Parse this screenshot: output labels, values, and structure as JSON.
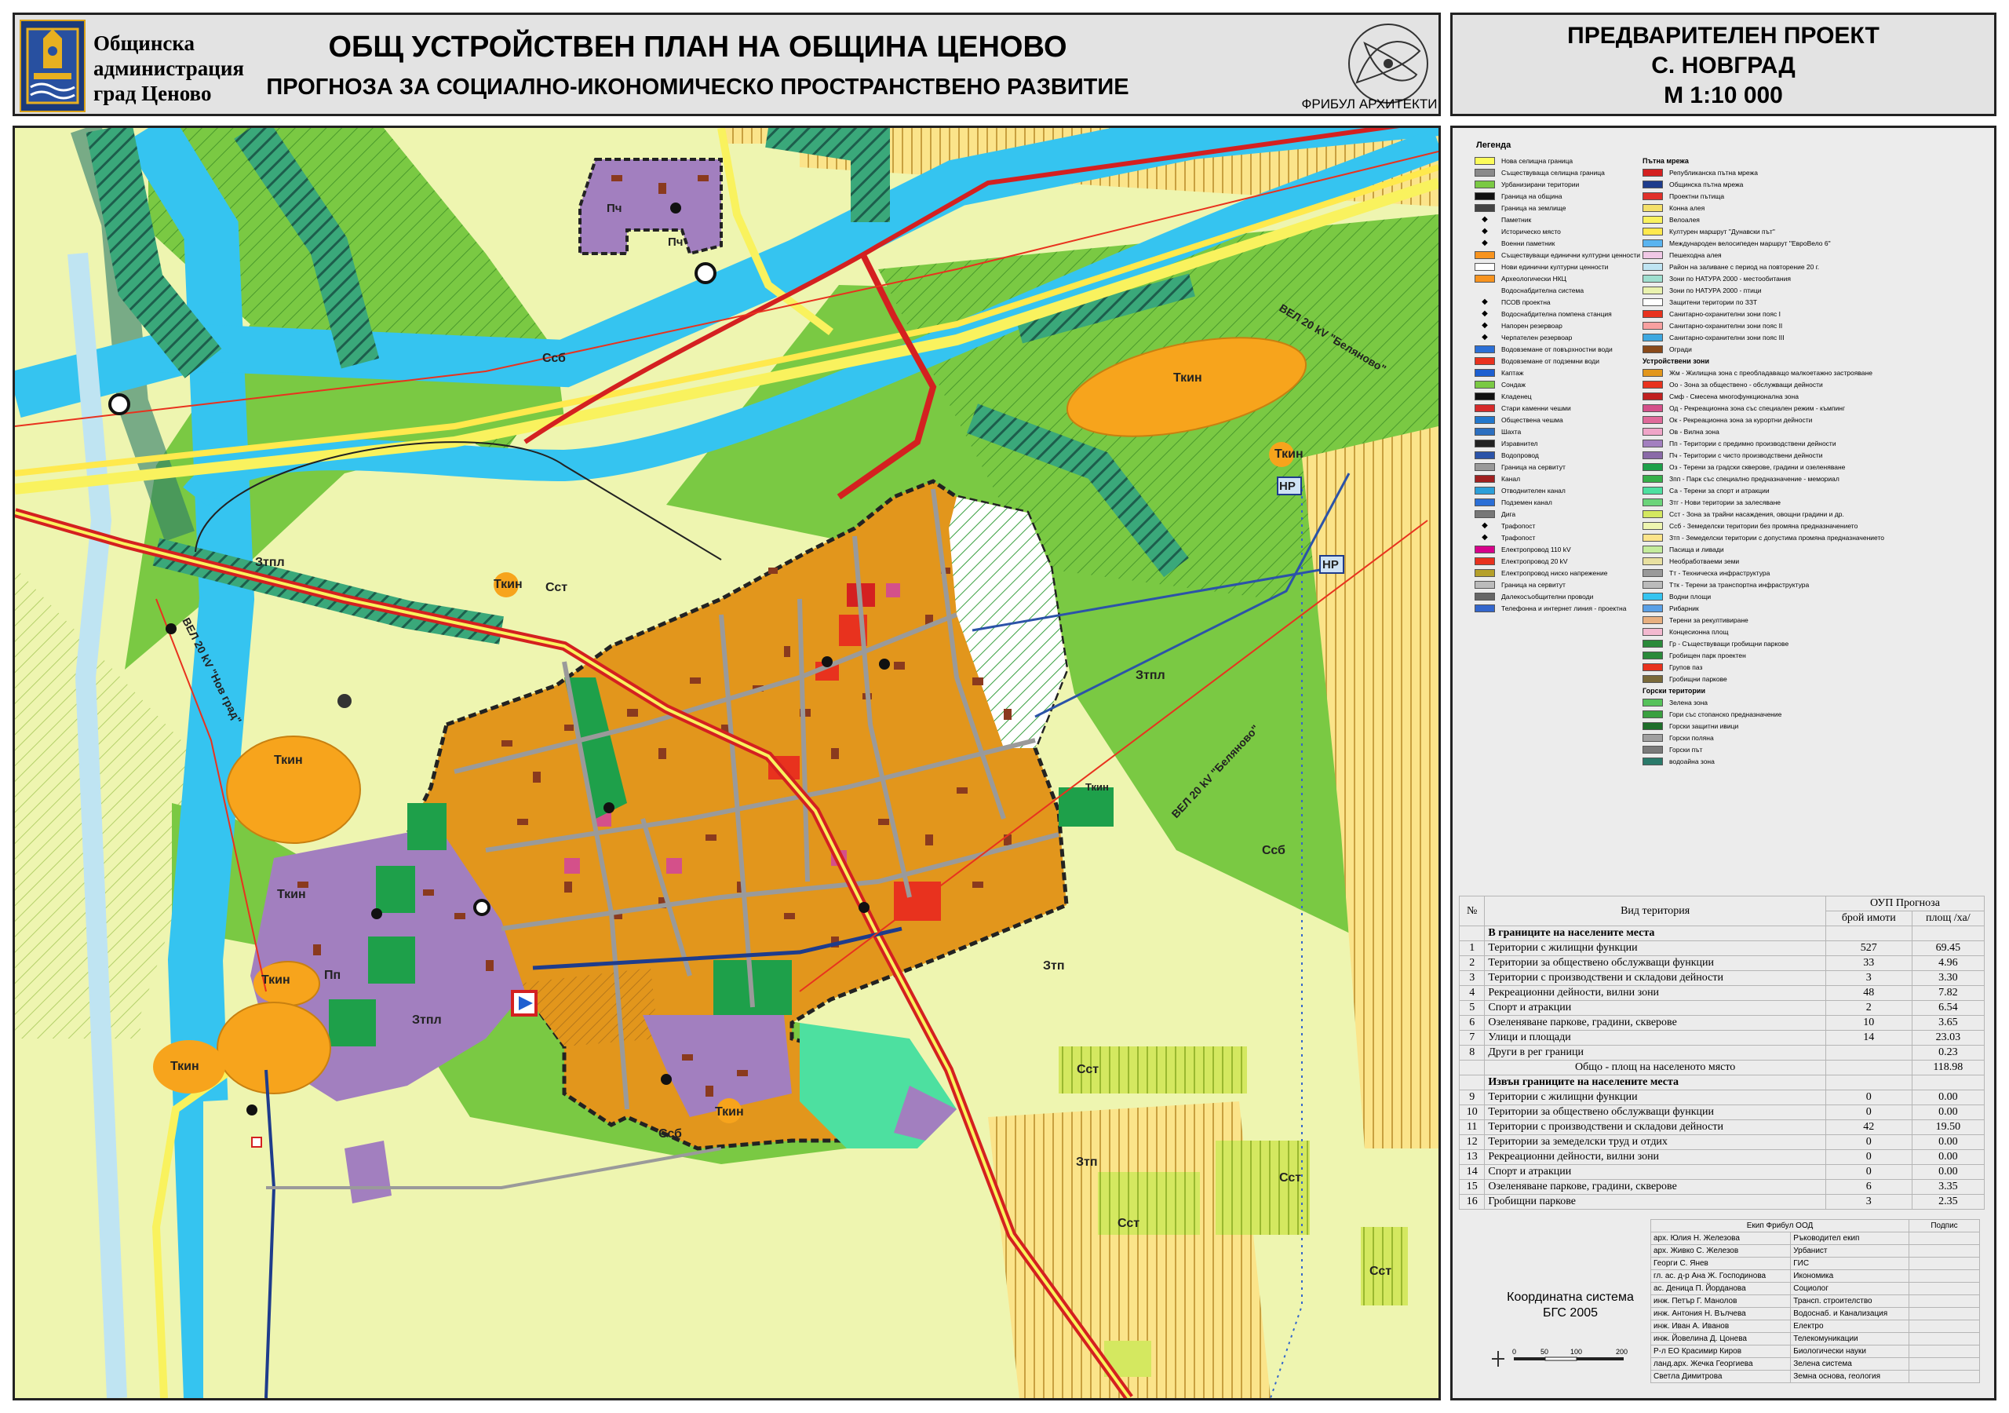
{
  "header": {
    "admin_lines": [
      "Общинска",
      "администрация",
      "град Ценово"
    ],
    "title": "ОБЩ УСТРОЙСТВЕН ПЛАН НА ОБЩИНА ЦЕНОВО",
    "subtitle": "ПРОГНОЗА ЗА СОЦИАЛНО-ИКОНОМИЧЕСКО ПРОСТРАНСТВЕНО РАЗВИТИЕ",
    "firm": "ФРИБУЛ АРХИТЕКТИ"
  },
  "project": {
    "line1": "ПРЕДВАРИТЕЛЕН ПРОЕКТ",
    "line2": "С. НОВГРАД",
    "line3": "М 1:10 000"
  },
  "map": {
    "labels": {
      "ssb_north": "Ссб",
      "tkin_ne": "Ткин",
      "tkin_east": "Ткин",
      "nr1": "НР",
      "nr2": "НР",
      "ztpl_west": "Зтпл",
      "tkin_center": "Ткин",
      "sst_center": "Сст",
      "ztpl_east": "Зтпл",
      "tkin_w1": "Ткин",
      "tkin_w2": "Ткин",
      "tkin_w3": "Ткин",
      "tkin_w4": "Ткин",
      "pp": "Пп",
      "ztpl_sw": "Зтпл",
      "ssb_south": "Ссб",
      "tkin_south": "Ткин",
      "ztp1": "Зтп",
      "ztp2": "Зтп",
      "sst_s1": "Сст",
      "sst_s2": "Сст",
      "sst_s3": "Сст",
      "sst_s4": "Сст",
      "ssb_east": "Ссб",
      "tkin_road": "Ткин",
      "vel_belyanovo_n": "ВЕЛ 20 kV \"Беляново\"",
      "vel_belyanovo_s": "ВЕЛ 20 kV \"Беляново\"",
      "vel_novgrad": "ВЕЛ 20 kV \"Нов град\"",
      "pch1": "Пч",
      "pch2": "Пч"
    }
  },
  "legend": {
    "title": "Легенда",
    "left_items": [
      {
        "label": "Нова селищна граница",
        "color": "#fcfc5a"
      },
      {
        "label": "Съществуваща селищна граница",
        "color": "#8a8a8a"
      },
      {
        "label": "Урбанизирани територии",
        "color": "#7ac943"
      },
      {
        "label": "Граница на община",
        "color": "#111111"
      },
      {
        "label": "Граница на землище",
        "color": "#444444"
      },
      {
        "label": "Паметник",
        "icon": "monument-icon"
      },
      {
        "label": "Историческо място",
        "icon": "historic-place-icon"
      },
      {
        "label": "Военни паметник",
        "icon": "military-monument-icon"
      },
      {
        "label": "Съществуващи единични културни ценности",
        "color": "#f7931e"
      },
      {
        "label": "Нови единични културни ценности",
        "color": "#ffffff"
      },
      {
        "label": "Археологически НКЦ",
        "color": "#f7931e"
      },
      {
        "label": "Водоснабдителна система",
        "color": ""
      },
      {
        "label": "ПСОВ проектна",
        "icon": "wastewater-plant-icon"
      },
      {
        "label": "Водоснабдителна помпена станция",
        "icon": "pump-station-icon"
      },
      {
        "label": "Напорен резервоар",
        "icon": "pressure-tank-icon"
      },
      {
        "label": "Черпателен резервоар",
        "icon": "intake-tank-icon"
      },
      {
        "label": "Водовземане от повърхностни води",
        "color": "#2b6fd6"
      },
      {
        "label": "Водовземане от подземни води",
        "color": "#e8321e"
      },
      {
        "label": "Каптаж",
        "color": "#1d5fd0"
      },
      {
        "label": "Сондаж",
        "color": "#7ac943"
      },
      {
        "label": "Кладенец",
        "color": "#111111"
      },
      {
        "label": "Стари каменни чешми",
        "color": "#d62a2a"
      },
      {
        "label": "Обществена чешма",
        "color": "#2277cc"
      },
      {
        "label": "Шахта",
        "color": "#2c6fbf"
      },
      {
        "label": "Изравнител",
        "color": "#222222"
      },
      {
        "label": "Водопровод",
        "color": "#2b53a8"
      },
      {
        "label": "Граница на сервитут",
        "color": "#999999"
      },
      {
        "label": "Канал",
        "color": "#a02020"
      },
      {
        "label": "Отводнителен канал",
        "color": "#2b9fd9"
      },
      {
        "label": "Подземен канал",
        "color": "#2b6fd6"
      },
      {
        "label": "Дига",
        "color": "#777777"
      },
      {
        "label": "Трафопост",
        "icon": "transformer-icon"
      },
      {
        "label": "Трафопост",
        "icon": "transformer-icon"
      },
      {
        "label": "Електропровод 110 kV",
        "color": "#d6008a"
      },
      {
        "label": "Електропровод 20 kV",
        "color": "#e8321e"
      },
      {
        "label": "Електропровод ниско напрежение",
        "color": "#b5a02a"
      },
      {
        "label": "Граница на сервитут",
        "color": "#bbbbbb"
      },
      {
        "label": "Далекосъобщителни проводи",
        "color": "#666666"
      },
      {
        "label": "Телефонна и интернет линия - проектна",
        "color": "#3366cc"
      }
    ],
    "right_items": [
      {
        "label": "Пътна мрежа",
        "header": true
      },
      {
        "label": "Републиканска пътна мрежа",
        "color": "#d42020"
      },
      {
        "label": "Общинска пътна мрежа",
        "color": "#1e3c8c"
      },
      {
        "label": "Проектни пътища",
        "color": "#e0302a"
      },
      {
        "label": "Конна алея",
        "color": "#f4e06a"
      },
      {
        "label": "Велоалея",
        "color": "#f9f25e"
      },
      {
        "label": "Културен маршрут \"Дунавски път\"",
        "color": "#ffe94d"
      },
      {
        "label": "Международен велосипеден маршрут \"ЕвроВело 6\"",
        "color": "#5ab4f0"
      },
      {
        "label": "Пешеходна алея",
        "color": "#f0c8e6"
      },
      {
        "label": "Район на заливане с период на повторение 20 г.",
        "color": "#bfe4f2"
      },
      {
        "label": "Зони по НАТУРА 2000 - местообитания",
        "color": "#9fdfcf"
      },
      {
        "label": "Зони по НАТУРА 2000 - птици",
        "color": "#e9f2ae"
      },
      {
        "label": "Защитени територии по ЗЗТ",
        "color": "#ffffff"
      },
      {
        "label": "Санитарно-охранителни зони пояс I",
        "color": "#e8321e"
      },
      {
        "label": "Санитарно-охранителни зони пояс II",
        "color": "#f8a0a0"
      },
      {
        "label": "Санитарно-охранителни зони пояс III",
        "color": "#3ea8e0"
      },
      {
        "label": "Огради",
        "color": "#8a4a1a"
      },
      {
        "label": "Устройствени зони",
        "header": true
      },
      {
        "label": "Жм - Жилищна зона с преобладаващо малкоетажно застрояване",
        "color": "#e2961c"
      },
      {
        "label": "Оо - Зона за обществено - обслужващи дейности",
        "color": "#e8321e"
      },
      {
        "label": "Смф - Смесена многофункционална зона",
        "color": "#c02020"
      },
      {
        "label": "Од - Рекреационна зона със специален режим - къмпинг",
        "color": "#d4508a"
      },
      {
        "label": "Ок - Рекреационна зона за курортни дейности",
        "color": "#e06a9a"
      },
      {
        "label": "Ов - Вилна зона",
        "color": "#f0a5c8"
      },
      {
        "label": "Пп - Територии с предимно производствени дейности",
        "color": "#a27fbf"
      },
      {
        "label": "Пч - Територии с чисто производствени дейности",
        "color": "#8a6aa8"
      },
      {
        "label": "Оз - Терени за градски скверове, градини и озеленяване",
        "color": "#1ea04a"
      },
      {
        "label": "Зпп - Парк със специално предназначение - мемориал",
        "color": "#36b04a"
      },
      {
        "label": "Са - Терени за спорт и атракции",
        "color": "#4de0a0"
      },
      {
        "label": "Зтг - Нови територии за залесяване",
        "color": "#6bd47a"
      },
      {
        "label": "Сст - Зона за трайни насаждения, овощни градини и др.",
        "color": "#d4e860"
      },
      {
        "label": "Ссб - Земеделски територии без промяна предназначението",
        "color": "#eef5b0"
      },
      {
        "label": "Зтп - Земеделски територии с допустима промяна предназначението",
        "color": "#fbe48a"
      },
      {
        "label": "Пасища и ливади",
        "color": "#c4ec9c"
      },
      {
        "label": "Необработваеми земи",
        "color": "#e8e0a0"
      },
      {
        "label": "Тт - Техническа инфраструктура",
        "color": "#999999"
      },
      {
        "label": "Ттк - Терени за транспортна инфраструктура",
        "color": "#bbbbbb"
      },
      {
        "label": "Водни площи",
        "color": "#35c4f0"
      },
      {
        "label": "Рибарник",
        "color": "#5aa0e6"
      },
      {
        "label": "Терени за рекултивиране",
        "color": "#e8b080"
      },
      {
        "label": "Концесионна площ",
        "color": "#f3b9d0"
      },
      {
        "label": "Гр - Съществуващи гробищни паркове",
        "color": "#2a8a3a"
      },
      {
        "label": "Гробищен парк проектен",
        "color": "#2a8a3a"
      },
      {
        "label": "Групов паз",
        "color": "#e8321e"
      },
      {
        "label": "Гробищни паркове",
        "color": "#7a6a3a"
      },
      {
        "label": "Горски територии",
        "header": true
      },
      {
        "label": "Зелена зона",
        "color": "#56c25a"
      },
      {
        "label": "Гори със стопанско предназначение",
        "color": "#3aa040"
      },
      {
        "label": "Горски защитни ивици",
        "color": "#1e6e2a"
      },
      {
        "label": "Горски поляна",
        "color": "#a0a0a0"
      },
      {
        "label": "Горски път",
        "color": "#7a7a7a"
      },
      {
        "label": "водоайна зона",
        "color": "#2a7a6a"
      }
    ]
  },
  "stats_table": {
    "headers": {
      "no": "№",
      "type": "Вид територия",
      "oup": "ОУП Прогноза",
      "count": "брой имоти",
      "area": "площ /ха/"
    },
    "section_in": "В границите на населените места",
    "rows_in": [
      {
        "no": "1",
        "name": "Територии с жилищни функции",
        "count": "527",
        "area": "69.45"
      },
      {
        "no": "2",
        "name": "Територии за обществено обслужващи функции",
        "count": "33",
        "area": "4.96"
      },
      {
        "no": "3",
        "name": "Територии с производствени и складови дейности",
        "count": "3",
        "area": "3.30"
      },
      {
        "no": "4",
        "name": "Рекреационни дейности, вилни зони",
        "count": "48",
        "area": "7.82"
      },
      {
        "no": "5",
        "name": "Спорт и атракции",
        "count": "2",
        "area": "6.54"
      },
      {
        "no": "6",
        "name": "Озеленяване паркове, градини, скверове",
        "count": "10",
        "area": "3.65"
      },
      {
        "no": "7",
        "name": "Улици и площади",
        "count": "14",
        "area": "23.03"
      },
      {
        "no": "8",
        "name": "Други в рег граници",
        "count": "",
        "area": "0.23"
      }
    ],
    "total_row": {
      "name": "Общо - площ на населеното място",
      "area": "118.98"
    },
    "section_out": "Извън границите на населените места",
    "rows_out": [
      {
        "no": "9",
        "name": "Територии с жилищни функции",
        "count": "0",
        "area": "0.00"
      },
      {
        "no": "10",
        "name": "Територии за обществено обслужващи функции",
        "count": "0",
        "area": "0.00"
      },
      {
        "no": "11",
        "name": "Територии с производствени и складови дейности",
        "count": "42",
        "area": "19.50"
      },
      {
        "no": "12",
        "name": "Територии за земеделски труд и отдих",
        "count": "0",
        "area": "0.00"
      },
      {
        "no": "13",
        "name": "Рекреационни дейности, вилни зони",
        "count": "0",
        "area": "0.00"
      },
      {
        "no": "14",
        "name": "Спорт и атракции",
        "count": "0",
        "area": "0.00"
      },
      {
        "no": "15",
        "name": "Озеленяване паркове, градини, скверове",
        "count": "6",
        "area": "3.35"
      },
      {
        "no": "16",
        "name": "Гробищни паркове",
        "count": "3",
        "area": "2.35"
      }
    ]
  },
  "team": {
    "title": "Екип Фрибул ООД",
    "sign_header": "Подпис",
    "members": [
      {
        "name": "арх. Юлия Н. Железова",
        "role": "Ръководител екип"
      },
      {
        "name": "арх. Живко С. Железов",
        "role": "Урбанист"
      },
      {
        "name": "Георги С. Янев",
        "role": "ГИС"
      },
      {
        "name": "гл. ас. д-р Ана Ж. Господинова",
        "role": "Икономика"
      },
      {
        "name": "ас. Деница П. Йорданова",
        "role": "Социолог"
      },
      {
        "name": "инж. Петър Г. Манолов",
        "role": "Трансп. строителство"
      },
      {
        "name": "инж. Антония Н. Вълчева",
        "role": "Водоснаб. и Канализация"
      },
      {
        "name": "инж. Иван А. Иванов",
        "role": "Електро"
      },
      {
        "name": "инж. Йовелина Д. Цонева",
        "role": "Телекомуникации"
      },
      {
        "name": "Р-л ЕО Красимир Киров",
        "role": "Биологически науки"
      },
      {
        "name": "ланд.арх. Жечка Георгиева",
        "role": "Зелена система"
      },
      {
        "name": "Светла Димитрова",
        "role": "Земна основа, геология"
      }
    ]
  },
  "coords": {
    "line1": "Координатна система",
    "line2": "БГС 2005"
  },
  "scale_ticks": [
    "0",
    "50",
    "100",
    "200"
  ],
  "colors": {
    "residential": "#e2961c",
    "public": "#e8321e",
    "production": "#a27fbf",
    "green": "#1ea04a",
    "sport": "#4de0a0",
    "water": "#35c4f0",
    "pasture": "#7ac943",
    "agri": "#eef5b0",
    "orchard": "#d4e860",
    "archaeology": "#f7a41c",
    "road_rep": "#d42020",
    "road_mun": "#1e3c8c"
  }
}
